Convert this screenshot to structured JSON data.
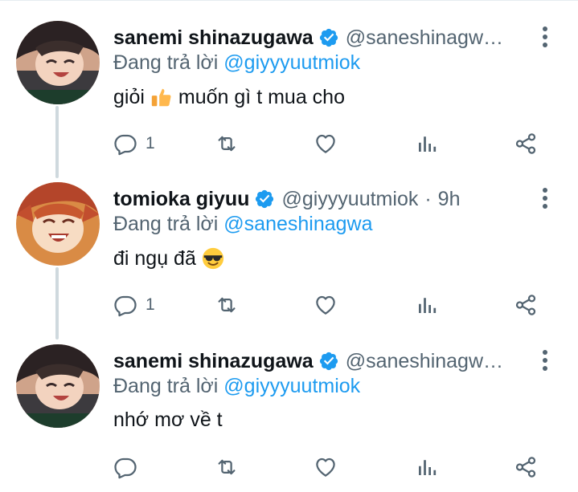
{
  "tweets": [
    {
      "name": "sanemi shinazugawa",
      "handle": "@saneshinagw…",
      "time": "",
      "reply_prefix": "Đang trả lời",
      "reply_mention": "@giyyyuutmiok",
      "text_before": "giỏi",
      "emoji": "thumbs-up",
      "text_after": "muốn gì t mua cho",
      "reply_count": "1",
      "avatar": "sanemi"
    },
    {
      "name": "tomioka giyuu",
      "handle": "@giyyyuutmiok",
      "dot": "·",
      "time": "9h",
      "reply_prefix": "Đang trả lời",
      "reply_mention": "@saneshinagwa",
      "text_before": "đi ngụ đã",
      "emoji": "sunglasses",
      "text_after": "",
      "reply_count": "1",
      "avatar": "giyuu"
    },
    {
      "name": "sanemi shinazugawa",
      "handle": "@saneshinagw…",
      "time": "",
      "reply_prefix": "Đang trả lời",
      "reply_mention": "@giyyyuutmiok",
      "text_before": "nhớ mơ về t",
      "emoji": "",
      "text_after": "",
      "reply_count": "",
      "avatar": "sanemi"
    }
  ],
  "colors": {
    "link": "#1d9bf0",
    "secondary_text": "#536471",
    "primary_text": "#0f1419",
    "thread_line": "#cfd9de"
  },
  "icons": [
    "reply-icon",
    "retweet-icon",
    "like-icon",
    "analytics-icon",
    "share-icon",
    "more-icon",
    "verified-icon"
  ]
}
